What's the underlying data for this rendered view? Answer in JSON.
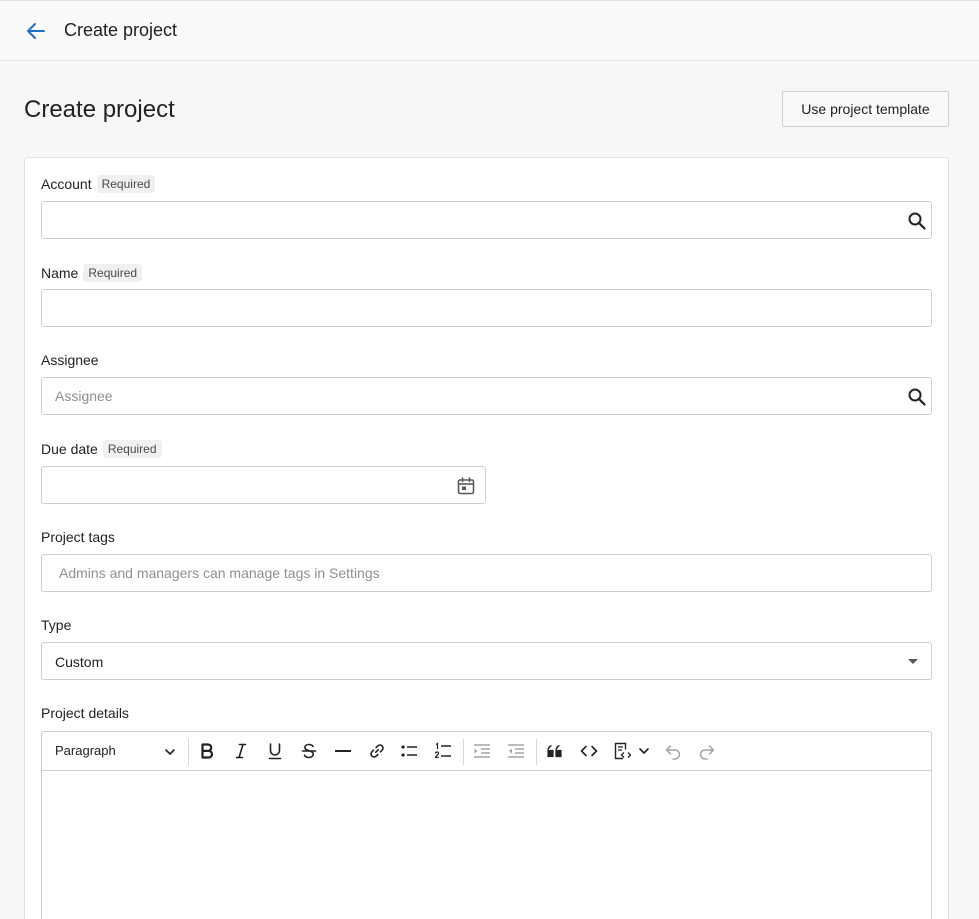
{
  "header": {
    "title": "Create project"
  },
  "page": {
    "title": "Create project",
    "template_button": "Use project template"
  },
  "form": {
    "account": {
      "label": "Account",
      "badge": "Required",
      "value": ""
    },
    "name": {
      "label": "Name",
      "badge": "Required",
      "value": ""
    },
    "assignee": {
      "label": "Assignee",
      "placeholder": "Assignee",
      "value": ""
    },
    "due_date": {
      "label": "Due date",
      "badge": "Required",
      "value": ""
    },
    "tags": {
      "label": "Project tags",
      "placeholder": "Admins and managers can manage tags in Settings"
    },
    "type": {
      "label": "Type",
      "value": "Custom"
    },
    "details": {
      "label": "Project details",
      "block_style": "Paragraph",
      "toolbar_icons": [
        "bold",
        "italic",
        "underline",
        "strikethrough",
        "horizontal-rule",
        "link",
        "bulleted-list",
        "numbered-list",
        "indent",
        "outdent",
        "blockquote",
        "code",
        "code-block",
        "undo",
        "redo"
      ]
    }
  },
  "colors": {
    "accent": "#1f6fc8",
    "border": "#cfcfcf",
    "muted_icon": "#a3a3a3"
  }
}
